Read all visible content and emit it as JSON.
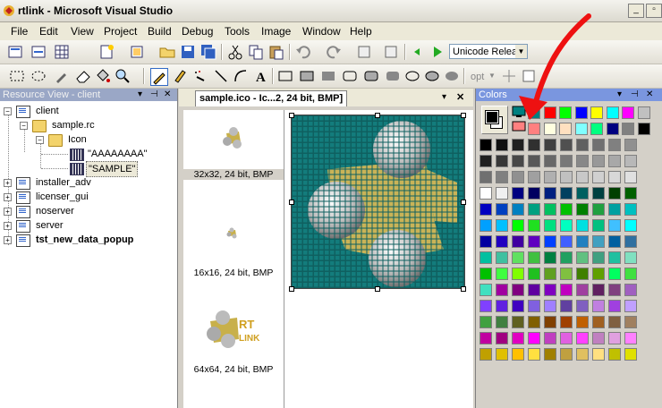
{
  "window": {
    "title": "rtlink - Microsoft Visual Studio"
  },
  "menu": [
    "File",
    "Edit",
    "View",
    "Project",
    "Build",
    "Debug",
    "Tools",
    "Image",
    "Window",
    "Help"
  ],
  "toolbar": {
    "config_combo": "Unicode Releas",
    "opt_label": "opt"
  },
  "resource_view": {
    "title": "Resource View - client",
    "items": {
      "client": "client",
      "sample_rc": "sample.rc",
      "icon_folder": "Icon",
      "icon_a": "\"AAAAAAAA\"",
      "icon_sample": "\"SAMPLE\"",
      "installer_adv": "installer_adv",
      "licenser_gui": "licenser_gui",
      "noserver": "noserver",
      "server": "server",
      "tst": "tst_new_data_popup"
    }
  },
  "editor": {
    "tab": "sample.ico - Ic...2, 24 bit, BMP]",
    "thumbs": [
      "32x32, 24 bit, BMP",
      "16x16, 24 bit, BMP",
      "64x64, 24 bit, BMP"
    ],
    "logo_text": "RT LINK"
  },
  "colors": {
    "title": "Colors",
    "top_row": [
      "#008080",
      "#ff0000",
      "#00ff00",
      "#0000ff",
      "#ffff00",
      "#00ffff",
      "#ff00ff",
      "#c0c0c0"
    ],
    "second_row": [
      "#ff8080",
      "#ffffe0",
      "#ffe0c0",
      "#80ffff",
      "#00ff80",
      "#000080",
      "#808080",
      "#000000"
    ],
    "palette": [
      [
        "#000000",
        "#101010",
        "#202020",
        "#303030",
        "#404040",
        "#505050",
        "#606060",
        "#707070",
        "#808080",
        "#909090"
      ],
      [
        "#202020",
        "#383838",
        "#484848",
        "#585858",
        "#686868",
        "#787878",
        "#888888",
        "#989898",
        "#a8a8a8",
        "#b8b8b8"
      ],
      [
        "#707070",
        "#808080",
        "#909090",
        "#a0a0a0",
        "#b0b0b0",
        "#c0c0c0",
        "#c8c8c8",
        "#d0d0d0",
        "#d8d8d8",
        "#e0e0e0"
      ],
      [
        "#ffffff",
        "#f0f0f0",
        "#000080",
        "#000060",
        "#002080",
        "#004060",
        "#006060",
        "#004040",
        "#004000",
        "#006000"
      ],
      [
        "#0000c0",
        "#0040c0",
        "#0080c0",
        "#00a080",
        "#00c060",
        "#00c000",
        "#008000",
        "#20a040",
        "#00a0a0",
        "#00c0c0"
      ],
      [
        "#00a0ff",
        "#00c0ff",
        "#00ff00",
        "#20e020",
        "#00e080",
        "#00ffc0",
        "#00e0e0",
        "#00c080",
        "#40c0ff",
        "#00ffff"
      ],
      [
        "#0000a0",
        "#2000c0",
        "#4000a0",
        "#6000c0",
        "#0040ff",
        "#4060ff",
        "#2080c0",
        "#40a0c0",
        "#0060a0",
        "#3070a0"
      ],
      [
        "#00c0a0",
        "#40c0a0",
        "#60e060",
        "#40c040",
        "#008040",
        "#20a060",
        "#60c080",
        "#40a080",
        "#20c0a0",
        "#80e0c0"
      ],
      [
        "#00c000",
        "#40ff40",
        "#80ff00",
        "#20c020",
        "#60a020",
        "#80c040",
        "#408000",
        "#60a000",
        "#00ff60",
        "#40e040"
      ],
      [
        "#40e0c0",
        "#a000a0",
        "#800080",
        "#6000a0",
        "#8000c0",
        "#c000c0",
        "#a040a0",
        "#602060",
        "#804080",
        "#a060c0"
      ],
      [
        "#8040ff",
        "#6020e0",
        "#4000c0",
        "#8060e0",
        "#a080ff",
        "#6040a0",
        "#8060c0",
        "#c080e0",
        "#a040e0",
        "#c0a0ff"
      ],
      [
        "#40a040",
        "#408040",
        "#606020",
        "#806000",
        "#804000",
        "#a04000",
        "#c06000",
        "#a06020",
        "#806040",
        "#a08060"
      ],
      [
        "#c000a0",
        "#a00080",
        "#e000c0",
        "#ff00ff",
        "#c040c0",
        "#e060e0",
        "#ff40ff",
        "#c080c0",
        "#e0a0e0",
        "#ff80ff"
      ],
      [
        "#c0a000",
        "#e0c000",
        "#ffc000",
        "#ffe040",
        "#a08000",
        "#c0a040",
        "#e0c060",
        "#ffe080",
        "#c0c000",
        "#e0e000"
      ]
    ]
  }
}
